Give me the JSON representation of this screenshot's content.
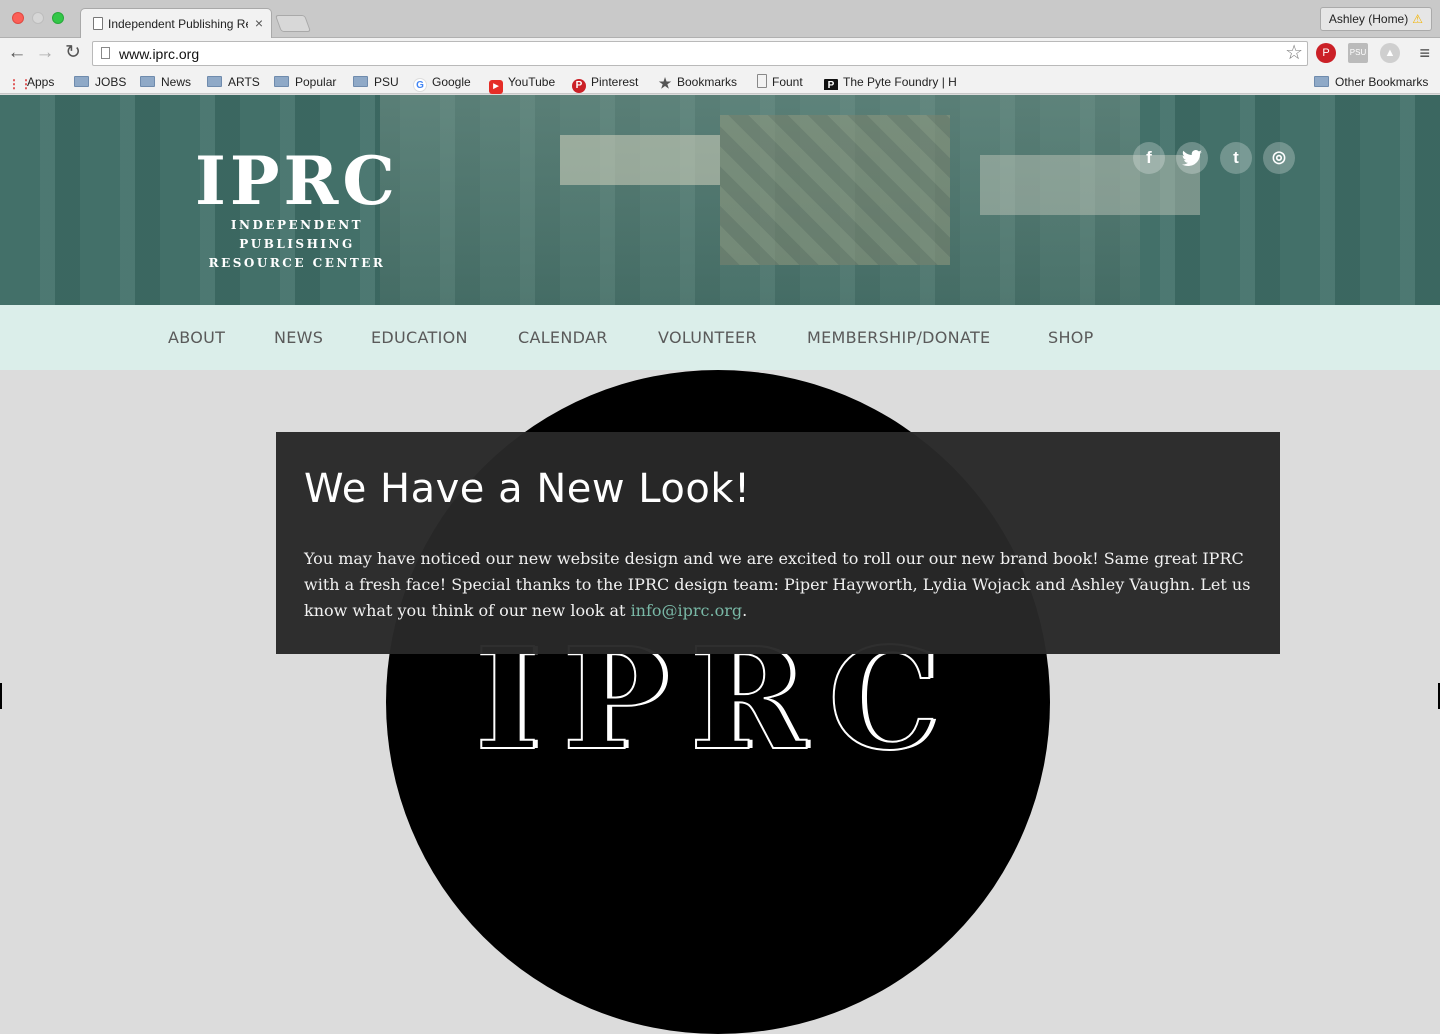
{
  "browser": {
    "tab_title": "Independent Publishing Re",
    "tab_close": "×",
    "profile": "Ashley (Home)",
    "url": "www.iprc.org",
    "back": "←",
    "forward": "→",
    "reload": "↻",
    "star": "☆",
    "menu": "≡"
  },
  "bookmarks": {
    "apps": "Apps",
    "items": [
      "JOBS",
      "News",
      "ARTS",
      "Popular",
      "PSU",
      "Google",
      "YouTube",
      "Pinterest",
      "Bookmarks",
      "Fount",
      "The Pyte Foundry | H"
    ],
    "other": "Other Bookmarks"
  },
  "header": {
    "logo_mark": "IPRC",
    "logo_line1": "INDEPENDENT PUBLISHING",
    "logo_line2": "RESOURCE CENTER",
    "social": [
      "f",
      "t",
      "t",
      "◎"
    ]
  },
  "nav": [
    "ABOUT",
    "NEWS",
    "EDUCATION",
    "CALENDAR",
    "VOLUNTEER",
    "MEMBERSHIP/DONATE",
    "SHOP"
  ],
  "main": {
    "big_logo": "IPRC",
    "heading": "We Have a New Look!",
    "body_text": "You may have noticed our new website design and we are excited to roll our our new brand book! Same great IPRC with a fresh face! Special thanks to the IPRC design team: Piper Hayworth, Lydia Wojack and Ashley Vaughn. Let us know what you think of our new look at ",
    "email": "info@iprc.org",
    "after_email": "."
  },
  "colors": {
    "nav_bg": "#dbeeea",
    "hero_tint": "#468c82",
    "link": "#79b8a6",
    "panel_bg": "#282828"
  }
}
